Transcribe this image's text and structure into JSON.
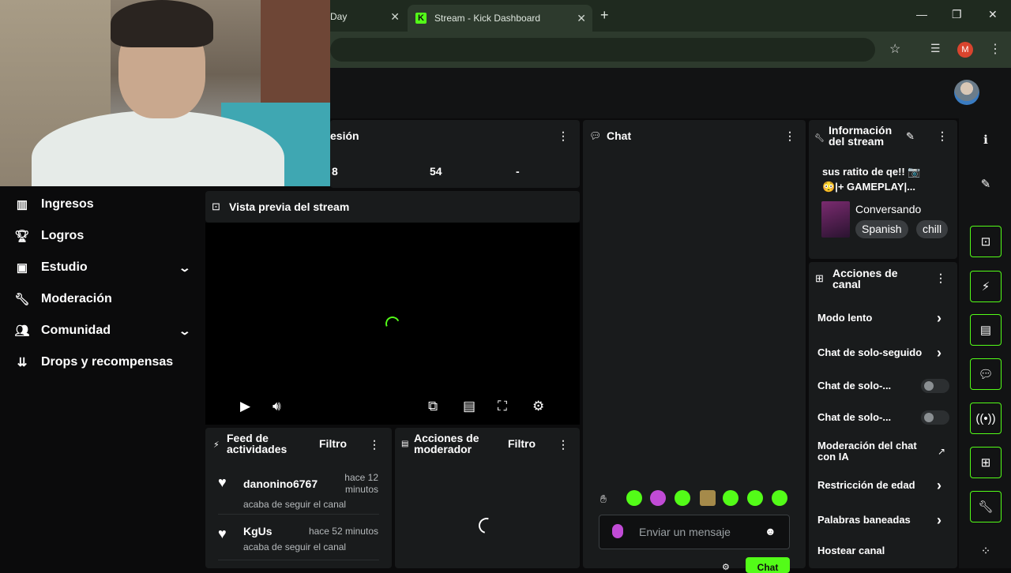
{
  "browser": {
    "tabs": [
      {
        "title": "Day",
        "close": "✕"
      },
      {
        "title": "Stream - Kick Dashboard",
        "close": "✕"
      }
    ],
    "new_tab": "+",
    "profile_initial": "M"
  },
  "nav": {
    "items": [
      {
        "label": "Ingresos"
      },
      {
        "label": "Logros"
      },
      {
        "label": "Estudio"
      },
      {
        "label": "Moderación"
      },
      {
        "label": "Comunidad"
      },
      {
        "label": "Drops y recompensas"
      }
    ]
  },
  "session": {
    "title": "esión",
    "stats": [
      "8",
      "54",
      "-"
    ]
  },
  "preview": {
    "title": "Vista previa del stream"
  },
  "chat": {
    "title": "Chat",
    "placeholder": "Enviar un mensaje",
    "send_label": "Chat"
  },
  "stream_info": {
    "title": "Información del stream",
    "stream_title": "sus ratito de qe!! 📷😳|+ GAMEPLAY|...",
    "category": "Conversando",
    "tags": [
      "Spanish",
      "chill"
    ]
  },
  "channel_actions": {
    "title": "Acciones de canal",
    "items": [
      {
        "label": "Modo lento"
      },
      {
        "label": "Chat de solo-seguido"
      },
      {
        "label": "Chat de solo-..."
      },
      {
        "label": "Chat de solo-..."
      },
      {
        "label": "Moderación del chat con IA"
      },
      {
        "label": "Restricción de edad"
      },
      {
        "label": "Palabras baneadas"
      },
      {
        "label": "Hostear canal"
      }
    ]
  },
  "activity": {
    "title": "Feed de actividades",
    "filter": "Filtro",
    "events": [
      {
        "user": "danonino6767",
        "action": "acaba de seguir el canal",
        "time": "hace 12 minutos"
      },
      {
        "user": "KgUs",
        "action": "acaba de seguir el canal",
        "time": "hace 52 minutos"
      }
    ]
  },
  "mod_actions": {
    "title": "Acciones de moderador",
    "filter": "Filtro"
  },
  "colors": {
    "accent": "#53fc18",
    "panel": "#191b1c",
    "background": "#0b0b0c"
  }
}
